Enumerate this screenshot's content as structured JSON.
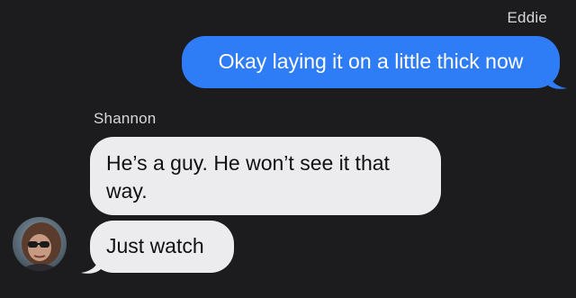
{
  "conversation": {
    "outgoing": {
      "sender": "Eddie",
      "message": "Okay laying it on a little thick now"
    },
    "incoming": {
      "sender": "Shannon",
      "messages": [
        "He’s a guy. He won’t see it that way.",
        "Just watch"
      ],
      "avatar_icon": "contact-photo-avatar"
    }
  },
  "colors": {
    "background": "#1c1c1e",
    "outgoing_bubble": "#2e7cf6",
    "incoming_bubble": "#ececef",
    "sender_label": "#d8d8dc"
  }
}
